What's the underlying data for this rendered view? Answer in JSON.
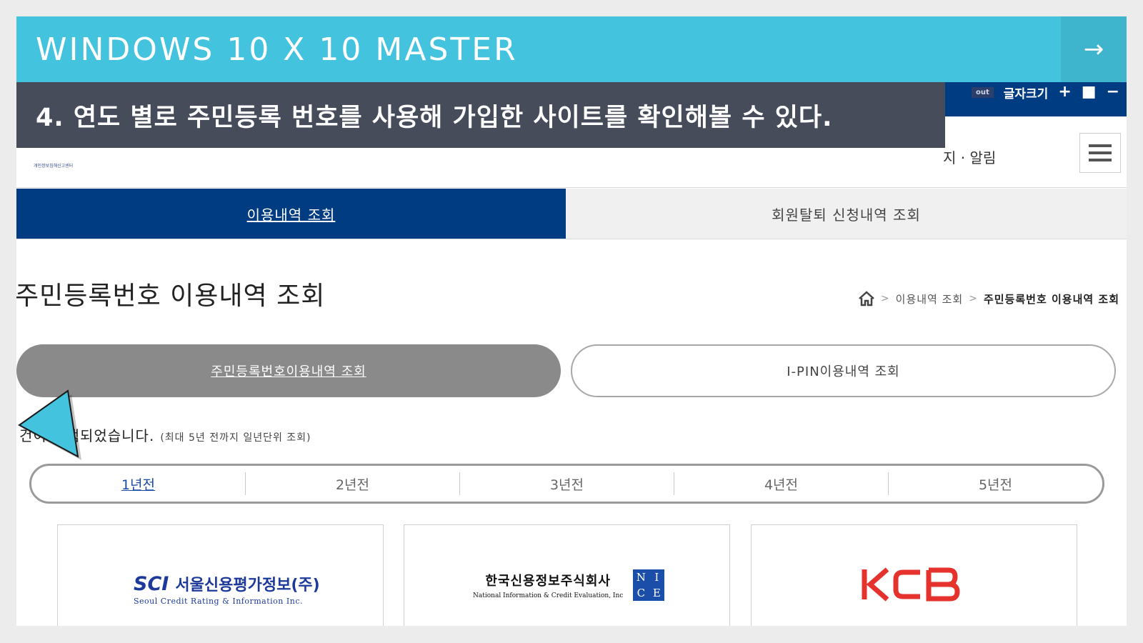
{
  "slide": {
    "title": "WINDOWS 10 X 10 MASTER",
    "next_glyph": "→",
    "caption": "4. 연도 별로 주민등록 번호를 사용해 가입한 사이트를 확인해볼 수 있다."
  },
  "site": {
    "topbar": {
      "pill": "out",
      "zoom_label": "글자크기",
      "plus": "+",
      "reset": "■",
      "minus": "−"
    },
    "header": {
      "logo_small": "개인정보침해신고센터",
      "notice_link": "지 · 알림"
    },
    "main_tabs": [
      {
        "label": "이용내역 조회"
      },
      {
        "label": "회원탈퇴 신청내역 조회"
      }
    ],
    "page_title": "주민등록번호 이용내역 조회",
    "breadcrumb": {
      "level1": "이용내역 조회",
      "current": "주민등록번호 이용내역 조회",
      "sep": ">"
    },
    "sub_tabs": [
      {
        "label": "주민등록번호이용내역 조회"
      },
      {
        "label": "I-PIN이용내역 조회"
      }
    ],
    "result": {
      "count_text": "건이 검색되었습니다.",
      "note": "(최대 5년 전까지 일년단위 조회)"
    },
    "year_tabs": [
      {
        "label": "1년전"
      },
      {
        "label": "2년전"
      },
      {
        "label": "3년전"
      },
      {
        "label": "4년전"
      },
      {
        "label": "5년전"
      }
    ],
    "bureaus": {
      "sci": {
        "mark": "SCI",
        "korean": "서울신용평가정보(주)",
        "english": "Seoul Credit Rating & Information Inc."
      },
      "nice": {
        "korean": "한국신용정보주식회사",
        "english": "National Information & Credit Evaluation, Inc",
        "box": [
          "N",
          "I",
          "C",
          "E"
        ]
      },
      "kcb": {
        "mark": "KCB"
      }
    }
  },
  "colors": {
    "banner": "#44c3de",
    "caption_bg": "#474c5b",
    "site_navy": "#003c82",
    "kcb_red": "#e5322d",
    "arrow": "#44c3de"
  },
  "icons": [
    "home-icon",
    "menu-icon",
    "arrow-right-icon",
    "pointer-arrow-icon"
  ]
}
